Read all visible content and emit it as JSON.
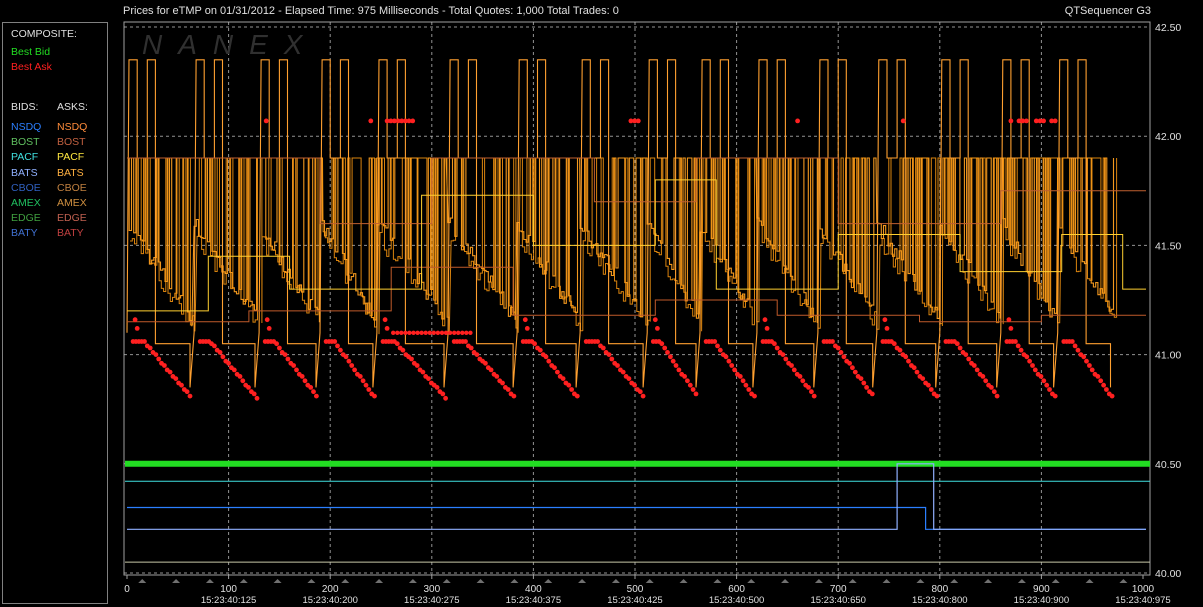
{
  "header": {
    "title": "Prices for  eTMP  on  01/31/2012  -  Elapsed Time: 975 Milliseconds  -  Total Quotes: 1,000  Total Trades: 0",
    "app_name": "QTSequencer G3"
  },
  "watermark": "NANEX",
  "legend": {
    "composite_label": "COMPOSITE:",
    "best_bid": "Best Bid",
    "best_ask": "Best Ask",
    "bids_label": "BIDS:",
    "asks_label": "ASKS:",
    "rows": [
      {
        "bid": "NSDQ",
        "ask": "NSDQ",
        "bid_color": "#2b7fff",
        "ask_color": "#ff8c3a"
      },
      {
        "bid": "BOST",
        "ask": "BOST",
        "bid_color": "#60c060",
        "ask_color": "#c06040"
      },
      {
        "bid": "PACF",
        "ask": "PACF",
        "bid_color": "#40e0e0",
        "ask_color": "#ffe840"
      },
      {
        "bid": "BATS",
        "ask": "BATS",
        "bid_color": "#90b0ff",
        "ask_color": "#ffb040"
      },
      {
        "bid": "CBOE",
        "ask": "CBOE",
        "bid_color": "#3060c0",
        "ask_color": "#c08040"
      },
      {
        "bid": "AMEX",
        "ask": "AMEX",
        "bid_color": "#20c060",
        "ask_color": "#d09040"
      },
      {
        "bid": "EDGE",
        "ask": "EDGE",
        "bid_color": "#40a040",
        "ask_color": "#c06050"
      },
      {
        "bid": "BATY",
        "ask": "BATY",
        "bid_color": "#4070d0",
        "ask_color": "#c04040"
      }
    ]
  },
  "colors": {
    "best_bid": "#22dd22",
    "best_ask": "#ff2020",
    "grid": "#b8b8b8",
    "axis_text": "#e0e0e0",
    "ask_orange": "#ffa020",
    "ask_brown": "#c06030",
    "ask_yellow": "#ffd030"
  },
  "chart_data": {
    "type": "line",
    "x_axis": {
      "range": [
        0,
        1000
      ],
      "ticks": [
        0,
        100,
        200,
        300,
        400,
        500,
        600,
        700,
        800,
        900,
        1000
      ],
      "time_labels": [
        {
          "x": 100,
          "label": "15:23:40:125"
        },
        {
          "x": 200,
          "label": "15:23:40:200"
        },
        {
          "x": 300,
          "label": "15:23:40:275"
        },
        {
          "x": 400,
          "label": "15:23:40:375"
        },
        {
          "x": 500,
          "label": "15:23:40:425"
        },
        {
          "x": 600,
          "label": "15:23:40:500"
        },
        {
          "x": 700,
          "label": "15:23:40:650"
        },
        {
          "x": 800,
          "label": "15:23:40:800"
        },
        {
          "x": 900,
          "label": "15:23:40:900"
        },
        {
          "x": 1000,
          "label": "15:23:40:975"
        }
      ]
    },
    "y_axis": {
      "range": [
        40.0,
        42.5
      ],
      "ticks": [
        "40.00",
        "40.50",
        "41.00",
        "41.50",
        "42.00",
        "42.50"
      ]
    },
    "grid": true,
    "cycles": [
      0,
      66,
      130,
      190,
      246,
      316,
      384,
      446,
      512,
      564,
      620,
      680,
      738,
      800,
      860,
      916,
      972
    ],
    "series": [
      {
        "name": "Best Bid",
        "type": "flat",
        "y": 40.5
      },
      {
        "name": "PACF",
        "type": "flat",
        "y": 40.42
      },
      {
        "name": "NSDQ",
        "type": "step",
        "points": [
          [
            0,
            40.3
          ],
          [
            786,
            40.3
          ],
          [
            786,
            40.2
          ],
          [
            1003,
            40.2
          ]
        ]
      },
      {
        "name": "BATS",
        "type": "step",
        "points": [
          [
            0,
            40.2
          ],
          [
            758,
            40.2
          ],
          [
            758,
            40.5
          ],
          [
            794,
            40.5
          ],
          [
            794,
            40.2
          ],
          [
            1003,
            40.2
          ]
        ]
      },
      {
        "name": "AMEX",
        "type": "flat",
        "y": 40.05
      }
    ]
  },
  "x_marker_count": 30
}
